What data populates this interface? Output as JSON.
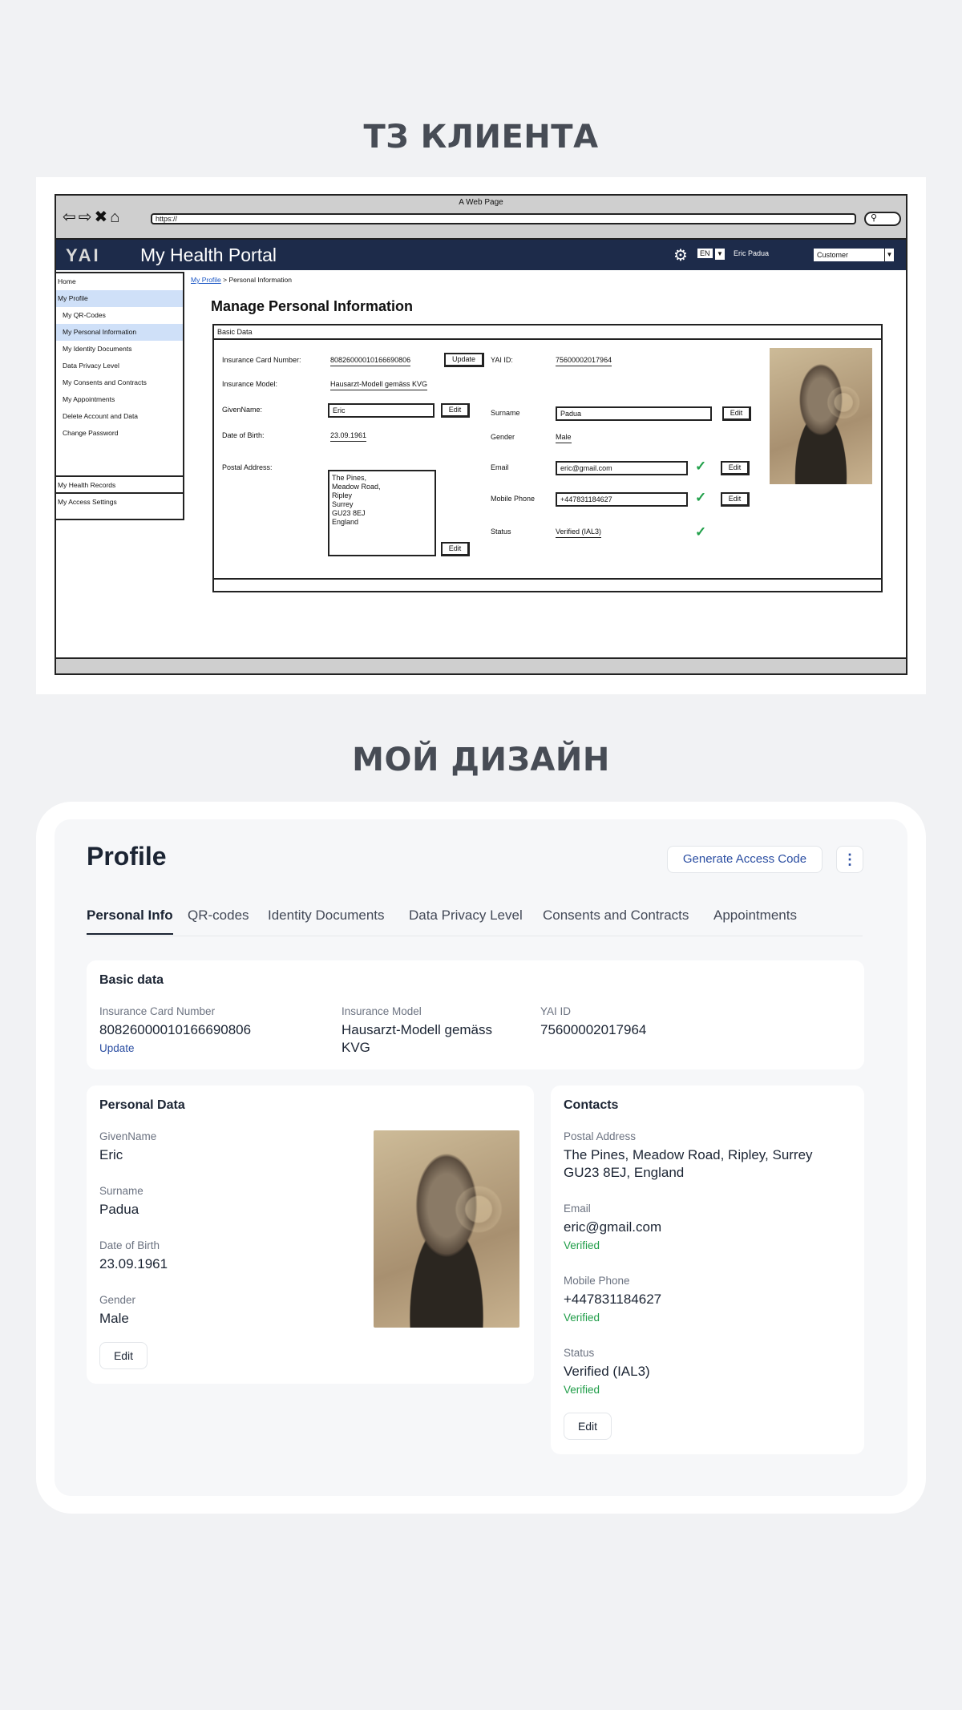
{
  "headings": {
    "client_spec": "ТЗ КЛИЕНТА",
    "my_design": "МОЙ ДИЗАЙН"
  },
  "wireframe": {
    "page_title": "A Web Page",
    "url": "https://",
    "logo": "YAI",
    "portal_title": "My Health Portal",
    "lang": "EN",
    "user": "Eric Padua",
    "role": "Customer",
    "sidebar": [
      "Home",
      "My Profile",
      "My QR-Codes",
      "My Personal Information",
      "My Identity Documents",
      "Data Privacy Level",
      "My Consents and Contracts",
      "My Appointments",
      "Delete Account and Data",
      "Change Password",
      "My Health Records",
      "My Access Settings"
    ],
    "breadcrumb": {
      "link": "My Profile",
      "current": "> Personal Information"
    },
    "heading": "Manage Personal Information",
    "box_title": "Basic Data",
    "labels": {
      "insurance_card": "Insurance Card Number:",
      "insurance_model": "Insurance Model:",
      "given_name": "GivenName:",
      "dob": "Date of Birth:",
      "postal": "Postal Address:",
      "yai_id": "YAI ID:",
      "surname": "Surname",
      "gender": "Gender",
      "email": "Email",
      "mobile": "Mobile Phone",
      "status": "Status"
    },
    "values": {
      "insurance_card": "80826000010166690806",
      "insurance_model": "Hausarzt-Modell gemäss KVG",
      "given_name": "Eric",
      "dob": "23.09.1961",
      "postal": "The Pines,\nMeadow Road,\nRipley\nSurrey\nGU23 8EJ\nEngland",
      "yai_id": "75600002017964",
      "surname": "Padua",
      "gender": "Male",
      "email": "eric@gmail.com",
      "mobile": "+447831184627",
      "status": "Verified (IAL3)"
    },
    "buttons": {
      "update": "Update",
      "edit": "Edit"
    }
  },
  "design": {
    "title": "Profile",
    "generate_button": "Generate Access Code",
    "more_icon": "⋮",
    "tabs": [
      "Personal Info",
      "QR-codes",
      "Identity Documents",
      "Data Privacy Level",
      "Consents and Contracts",
      "Appointments"
    ],
    "basic": {
      "title": "Basic data",
      "insurance_card_label": "Insurance Card Number",
      "insurance_card_value": "80826000010166690806",
      "update_link": "Update",
      "insurance_model_label": "Insurance Model",
      "insurance_model_value_1": "Hausarzt-Modell gemäss",
      "insurance_model_value_2": "KVG",
      "yai_label": "YAI ID",
      "yai_value": "75600002017964"
    },
    "personal": {
      "title": "Personal Data",
      "given_label": "GivenName",
      "given_value": "Eric",
      "surname_label": "Surname",
      "surname_value": "Padua",
      "dob_label": "Date of Birth",
      "dob_value": "23.09.1961",
      "gender_label": "Gender",
      "gender_value": "Male",
      "edit": "Edit"
    },
    "contacts": {
      "title": "Contacts",
      "postal_label": "Postal Address",
      "postal_value_1": "The Pines, Meadow Road, Ripley, Surrey",
      "postal_value_2": "GU23 8EJ, England",
      "email_label": "Email",
      "email_value": "eric@gmail.com",
      "email_status": "Verified",
      "mobile_label": "Mobile Phone",
      "mobile_value": "+447831184627",
      "mobile_status": "Verified",
      "status_label": "Status",
      "status_value": "Verified (IAL3)",
      "status_status": "Verified",
      "edit": "Edit"
    }
  }
}
